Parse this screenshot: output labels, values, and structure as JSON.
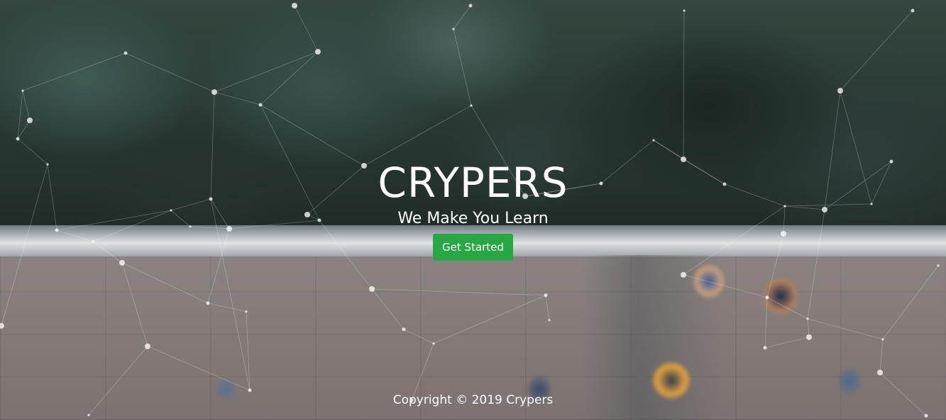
{
  "hero": {
    "title": "CRYPERS",
    "subtitle": "We Make You Learn",
    "cta_label": "Get Started"
  },
  "footer": {
    "copyright": "Copyright © 2019 Crypers"
  },
  "colors": {
    "cta_background": "#28a745",
    "text": "#ffffff"
  }
}
